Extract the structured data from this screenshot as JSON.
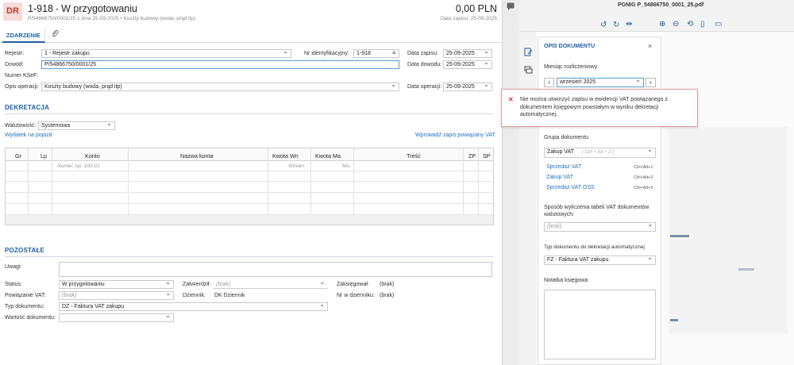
{
  "header": {
    "badge": "DR",
    "doc_number": "1-918",
    "separator": "•",
    "status_title": "W przygotowaniu",
    "subtitle": "P/54866750/0001/25 z dnia 25-09-2025 • Koszty budowy (woda, prąd itp)",
    "amount": "0,00 PLN",
    "entry_date": "Data zapisu: 25-09-2025"
  },
  "tabs": {
    "event": "ZDARZENIE"
  },
  "form": {
    "register_label": "Rejestr:",
    "register_value": "1 - Rejestr zakupu",
    "idnum_label": "Nr identyfikacyjny:",
    "idnum_value": "1-918",
    "entry_date_label": "Data zapisu:",
    "entry_date_value": "25-09-2025",
    "proof_label": "Dowód:",
    "proof_value": "P/54866750/0001/25",
    "proof_date_label": "Data dowodu:",
    "proof_date_value": "25-09-2025",
    "ksef_label": "Numer KSeF:",
    "op_desc_label": "Opis operacji:",
    "op_desc_value": "Koszty budowy (woda, prąd itp)",
    "op_date_label": "Data operacji:",
    "op_date_value": "25-09-2025"
  },
  "dekretacja": {
    "title": "DEKRETACJA",
    "currency_label": "Walutowość:",
    "currency_value": "Systemowa",
    "vehicle_link": "Wydatek na pojazd",
    "related_vat_link": "Wprowadź zapis powiązany VAT",
    "columns": [
      "Gr",
      "Lp",
      "Konto",
      "Nazwa konta",
      "Kwota Wn",
      "Kwota Ma",
      "Treść",
      "ZP",
      "SP"
    ],
    "placeholders": {
      "konto": "Numer, np. 100-01",
      "wn": "Winien",
      "ma": "Ma"
    }
  },
  "pozostale": {
    "title": "POZOSTAŁE",
    "notes_label": "Uwagi:",
    "status_label": "Status:",
    "status_value": "W przygotowaniu",
    "approver_label": "Zatwierdził:",
    "approver_value": "(brak)",
    "booked_label": "Zaksięgował:",
    "booked_value": "(brak)",
    "vat_link_label": "Powiązanie VAT:",
    "vat_link_value": "(brak)",
    "journal_label": "Dziennik:",
    "journal_value": "DK  Dziennik",
    "journal_nr_label": "Nr w dzienniku:",
    "journal_nr_value": "(brak)",
    "doc_type_label": "Typ dokumentu:",
    "doc_type_value": "DZ - Faktura VAT zakupu",
    "doc_value_label": "Wartość dokumentu:"
  },
  "viewer": {
    "filename": "PGNIG P_54866750_0001_25.pdf"
  },
  "opis": {
    "title": "OPIS DOKUMENTU",
    "month_label": "Miesiąc rozliczeniowy",
    "month_value": "wrzesień 2025",
    "group_label": "Grupa dokumentu",
    "group_value": "Zakup VAT",
    "group_hint": "( Ctrl + Alt + 2 )",
    "group_options": [
      {
        "label": "Sprzedaż VAT",
        "shortcut": "Ctrl+Alt+1"
      },
      {
        "label": "Zakup VAT",
        "shortcut": "Ctrl+Alt+2"
      },
      {
        "label": "Sprzedaż VAT OSS",
        "shortcut": "Ctrl+Alt+3"
      }
    ],
    "calc_label": "Sposób wyliczenia tabeli VAT dokumentów walutowych:",
    "calc_value": "(brak)",
    "autotype_label": "Typ dokumentu do dekretacji automatycznej",
    "autotype_value": "FZ - Faktura VAT zakupu",
    "note_label": "Notatka księgowa"
  },
  "error": {
    "message": "Nie można utworzyć zapisu w ewidencji VAT powiązanego z dokumentem księgowym powstałym w wyniku dekretacji automatycznej."
  },
  "colors": {
    "accent": "#1f5fa7",
    "badge_bg": "#f6dcdc",
    "badge_text": "#c0392b",
    "error": "#d9342b"
  }
}
